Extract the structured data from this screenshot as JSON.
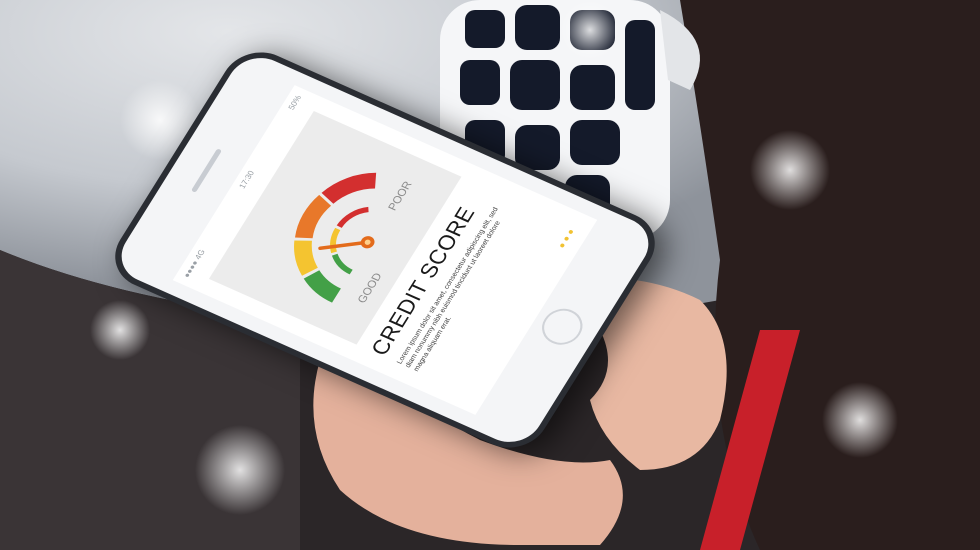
{
  "phone": {
    "status": {
      "signal": "●●●● 4G",
      "time": "17:30",
      "battery": "50%"
    },
    "gauge": {
      "good_label": "GOOD",
      "poor_label": "POOR"
    },
    "title": "CREDIT SCORE",
    "body_text": "Lorem ipsum dolor sit amet, consectetur adipiscing elit, sed diam nonummy nibh euismod tincidunt ut laoreet dolore magna aliquam erat.",
    "page_dots": 3
  },
  "colors": {
    "gauge_green": "#43a047",
    "gauge_yellow": "#f4c430",
    "gauge_orange": "#e8782a",
    "gauge_red": "#d32f2f",
    "needle": "#e36b1b",
    "accent_dot": "#f1c232"
  }
}
